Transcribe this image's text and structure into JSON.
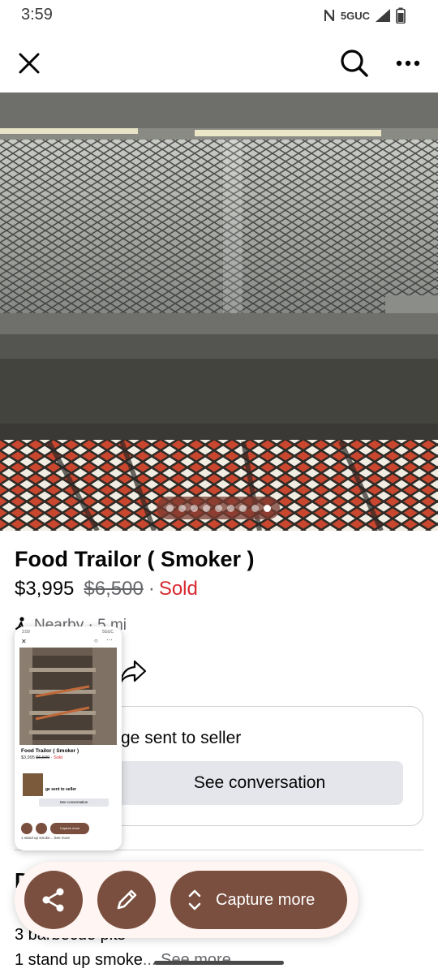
{
  "status_bar": {
    "time": "3:59",
    "network": "5GUC",
    "icons": [
      "nfc-icon",
      "signal-icon",
      "battery-icon"
    ]
  },
  "header": {
    "icons": [
      "close-icon",
      "search-icon",
      "more-icon"
    ]
  },
  "photo": {
    "dot_count": 9,
    "active_index": 8
  },
  "listing": {
    "title": "Food Trailor ( Smoker )",
    "price": "$3,995",
    "original_price": "$6,500",
    "separator": "·",
    "status": "Sold",
    "location_text": "Nearby · 5 mi"
  },
  "message_card": {
    "text_visible": "ge sent to seller",
    "button_label": "See conversation"
  },
  "description": {
    "heading_visible": "D",
    "line1": "3 barbecue pits",
    "line2_prefix": "1 stand up smoke",
    "see_more_label": "... See more"
  },
  "screenshot_thumbnail": {
    "status_time": "3:59",
    "status_right": "5GUC",
    "title": "Food Trailor ( Smoker )",
    "price": "$3,995",
    "original_price": "$6,500",
    "status": "Sold",
    "message": "ge sent to seller",
    "button": "See conversation",
    "capture_label": "Capture more",
    "footer": "1 stand up smoke... See more"
  },
  "capture_toolbar": {
    "capture_more_label": "Capture more",
    "icons": [
      "share-icon",
      "edit-icon",
      "expand-icon"
    ]
  },
  "colors": {
    "sold": "#d8292f",
    "secondary_text": "#65676b",
    "toolbar_button": "#7a4f3f",
    "toolbar_bg": "#fff5f2",
    "conversation_button": "#e4e6eb"
  }
}
